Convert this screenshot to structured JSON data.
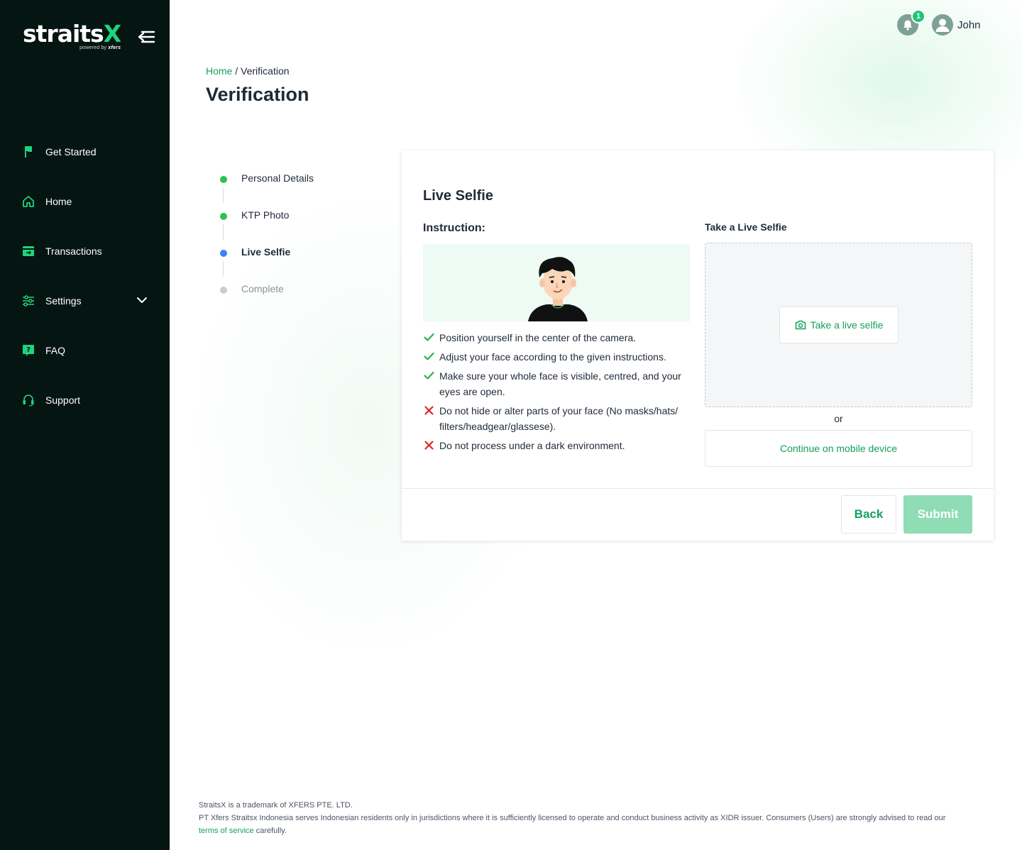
{
  "brand": {
    "name_main": "straits",
    "name_accent": "X",
    "tagline": "powered by",
    "tagline_brand": "xfers"
  },
  "sidebar": {
    "items": [
      {
        "label": "Get Started",
        "icon": "flag-icon"
      },
      {
        "label": "Home",
        "icon": "home-icon"
      },
      {
        "label": "Transactions",
        "icon": "transactions-icon"
      },
      {
        "label": "Settings",
        "icon": "sliders-icon"
      },
      {
        "label": "FAQ",
        "icon": "question-icon"
      },
      {
        "label": "Support",
        "icon": "headset-icon"
      }
    ]
  },
  "header": {
    "notification_count": "1",
    "user_name": "John"
  },
  "breadcrumb": {
    "home": "Home",
    "separator": " / ",
    "current": "Verification"
  },
  "page_title": "Verification",
  "stepper": {
    "steps": [
      {
        "label": "Personal Details",
        "status": "done"
      },
      {
        "label": "KTP Photo",
        "status": "done"
      },
      {
        "label": "Live Selfie",
        "status": "active"
      },
      {
        "label": "Complete",
        "status": "pending"
      }
    ]
  },
  "card": {
    "title": "Live Selfie",
    "instruction_title": "Instruction:",
    "instructions": [
      {
        "type": "do",
        "text": "Position yourself in the center of the camera."
      },
      {
        "type": "do",
        "text": "Adjust your face according to the given instructions."
      },
      {
        "type": "do",
        "text": "Make sure your whole face is visible, centred, and your eyes are open."
      },
      {
        "type": "dont",
        "text": "Do not hide or alter parts of your face (No masks/hats/ filters/headgear/glassese)."
      },
      {
        "type": "dont",
        "text": "Do not process under a dark environment."
      }
    ],
    "take_title": "Take a Live Selfie",
    "take_button": "Take a live selfie",
    "or": "or",
    "mobile_button": "Continue on mobile device",
    "back_button": "Back",
    "submit_button": "Submit"
  },
  "footer": {
    "line1": "StraitsX is a trademark of XFERS PTE. LTD.",
    "line2": "PT Xfers Straitsx Indonesia serves Indonesian residents only in jurisdictions where it is sufficiently licensed to operate and conduct business activity as XIDR issuer. Consumers (Users) are strongly advised to read our",
    "link": "terms of service",
    "line3": " carefully."
  },
  "colors": {
    "sidebar_bg": "#051512",
    "accent": "#12a05c",
    "accent_bright": "#1ed37c",
    "step_done": "#2bc24c",
    "step_active": "#3b82f6",
    "step_pending": "#c8cdd0",
    "error": "#e02424",
    "submit_disabled": "#8fdcb5"
  }
}
